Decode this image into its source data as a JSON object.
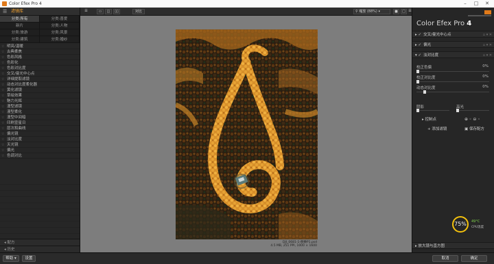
{
  "window": {
    "title": "Color Efex Pro 4",
    "app_icon": "color-efex-icon"
  },
  "left_panel": {
    "header_label": "滤镜库",
    "categories": [
      {
        "label": "分类:所有",
        "active": true
      },
      {
        "label": "分类:喜爱",
        "active": false
      },
      {
        "label": "新片",
        "active": false
      },
      {
        "label": "分类:人物",
        "active": false
      },
      {
        "label": "分类:旅游",
        "active": false
      },
      {
        "label": "分类:风景",
        "active": false
      },
      {
        "label": "分类:建筑",
        "active": false
      },
      {
        "label": "分类:婚纱",
        "active": false
      }
    ],
    "filters": [
      "明亮/温暖",
      "古典柔焦",
      "色彩风格",
      "色彩化",
      "色彩对比度",
      "交叉/曼光中心点",
      "详细提取滤镜",
      "动态对比度柔化器",
      "黄化滤镜",
      "草绘效果",
      "魅力光辉",
      "漫型滤镜",
      "漫型柔化",
      "漫型中间暗",
      "印刷宣星日",
      "层次和曲线",
      "偏光镜",
      "淡对比度",
      "天光镜",
      "偏光",
      "色调对比"
    ],
    "bottom": [
      "配方",
      "历史"
    ]
  },
  "bottom_bar": {
    "help": "帮助",
    "settings": "设置",
    "cancel": "取消",
    "ok": "确定"
  },
  "toolbar": {
    "compare": "对比",
    "zoom": "缩放 (88%)"
  },
  "canvas": {
    "filename": "DJI_0681-1-替换P1.psd",
    "info": "4.5 MB, 251 PPI, 1000 × 1600"
  },
  "right_panel": {
    "brand_text": "Color Efex Pro",
    "brand_num": "4",
    "sections": [
      {
        "label": "交叉/曼光中心点"
      },
      {
        "label": "偏光"
      },
      {
        "label": "淡对比度"
      }
    ],
    "params": [
      {
        "label": "校正色偏",
        "value": "0%"
      },
      {
        "label": "校正对比度",
        "value": "0%"
      },
      {
        "label": "动态对比度",
        "value": "0%"
      },
      {
        "label": "阴影",
        "value": ""
      },
      {
        "label": "高光",
        "value": ""
      }
    ],
    "control_points": "控制点",
    "add_filter": "添加滤镜",
    "save_recipe": "保存配方",
    "cpu_value": "75%",
    "cpu_temp": "49°C",
    "cpu_label": "CPU温度",
    "footer": "放大镜与直方图"
  }
}
